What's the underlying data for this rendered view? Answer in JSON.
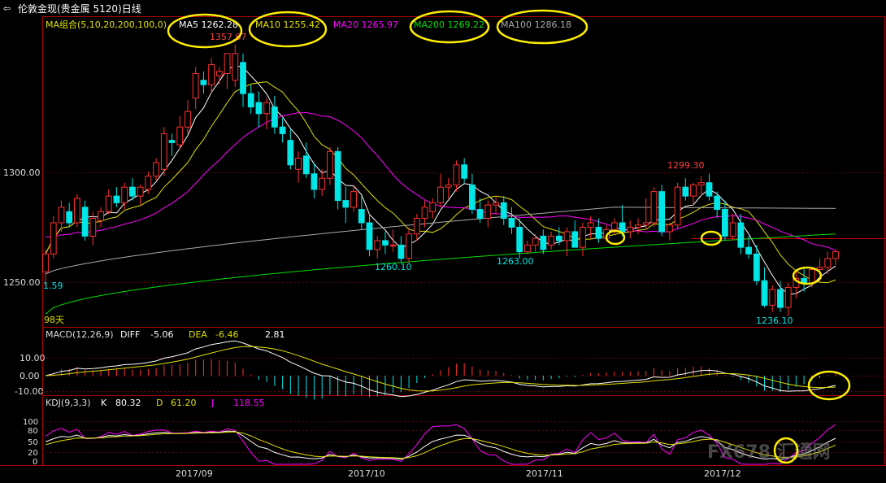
{
  "window": {
    "icon": "back-arrow-icon",
    "title": "伦敦金现(贵金属 5120)日线"
  },
  "legend": [
    {
      "text": "MA组合(5,10,20,200,100,0)",
      "color": "#e0e000"
    },
    {
      "text": "MA5 1262.28",
      "color": "#ffffff"
    },
    {
      "text": "MA10 1255.42",
      "color": "#e0e000"
    },
    {
      "text": "MA20 1265.97",
      "color": "#ff00ff"
    },
    {
      "text": "MA200 1269.22",
      "color": "#00dd00"
    },
    {
      "text": "MA100 1286.18",
      "color": "#aaaaaa"
    }
  ],
  "annotations": [
    {
      "text": "1357.67",
      "color": "#ff4040"
    },
    {
      "text": "1299.30",
      "color": "#ff4040"
    },
    {
      "text": "1260.10",
      "color": "#00e5e5"
    },
    {
      "text": "1263.00",
      "color": "#00e5e5"
    },
    {
      "text": "1236.10",
      "color": "#00e5e5"
    },
    {
      "text": "1.59",
      "color": "#00e5e5"
    },
    {
      "text": "98天",
      "color": "#e0e000"
    }
  ],
  "macd_header": {
    "title": "MACD(12,26,9)",
    "diff_label": "DIFF",
    "diff_value": "-5.06",
    "dea_label": "DEA",
    "dea_value": "-6.46",
    "macd_value": "2.81"
  },
  "kdj_header": {
    "title": "KDJ(9,3,3)",
    "k_label": "K",
    "k_value": "80.32",
    "d_label": "D",
    "d_value": "61.20",
    "j_label": "J",
    "j_value": "118.55"
  },
  "watermark": "FX678 汇通网",
  "chart_data": [
    {
      "type": "candlestick",
      "title": "伦敦金现(贵金属 5120)日线",
      "yticks": [
        "1300.00",
        "1250.00"
      ],
      "ylim": [
        1232,
        1370
      ],
      "xticks": [
        "2017/09",
        "2017/10",
        "2017/11",
        "2017/12"
      ],
      "candles_ohlc": [
        [
          1256,
          1266,
          1250,
          1264
        ],
        [
          1264,
          1281,
          1262,
          1278
        ],
        [
          1278,
          1288,
          1274,
          1285
        ],
        [
          1283,
          1287,
          1276,
          1278
        ],
        [
          1278,
          1291,
          1276,
          1289
        ],
        [
          1285,
          1288,
          1270,
          1272
        ],
        [
          1272,
          1283,
          1268,
          1280
        ],
        [
          1279,
          1285,
          1276,
          1283
        ],
        [
          1283,
          1293,
          1282,
          1290
        ],
        [
          1290,
          1294,
          1285,
          1287
        ],
        [
          1287,
          1296,
          1284,
          1294
        ],
        [
          1294,
          1298,
          1288,
          1290
        ],
        [
          1290,
          1295,
          1286,
          1294
        ],
        [
          1293,
          1301,
          1291,
          1299
        ],
        [
          1299,
          1307,
          1297,
          1305
        ],
        [
          1302,
          1321,
          1299,
          1318
        ],
        [
          1315,
          1318,
          1308,
          1314
        ],
        [
          1313,
          1326,
          1311,
          1321
        ],
        [
          1321,
          1333,
          1318,
          1328
        ],
        [
          1334,
          1348,
          1329,
          1345
        ],
        [
          1342,
          1346,
          1336,
          1340
        ],
        [
          1340,
          1352,
          1336,
          1349
        ],
        [
          1344,
          1348,
          1340,
          1346
        ],
        [
          1345,
          1352,
          1338,
          1354
        ],
        [
          1342,
          1358,
          1339,
          1354
        ],
        [
          1350,
          1354,
          1330,
          1336
        ],
        [
          1336,
          1340,
          1327,
          1330
        ],
        [
          1332,
          1337,
          1321,
          1327
        ],
        [
          1327,
          1334,
          1320,
          1332
        ],
        [
          1330,
          1335,
          1318,
          1321
        ],
        [
          1321,
          1325,
          1314,
          1318
        ],
        [
          1315,
          1320,
          1302,
          1304
        ],
        [
          1302,
          1310,
          1296,
          1307
        ],
        [
          1308,
          1314,
          1298,
          1300
        ],
        [
          1300,
          1305,
          1289,
          1293
        ],
        [
          1293,
          1302,
          1290,
          1298
        ],
        [
          1298,
          1312,
          1295,
          1310
        ],
        [
          1310,
          1312,
          1284,
          1288
        ],
        [
          1288,
          1294,
          1278,
          1285
        ],
        [
          1285,
          1295,
          1283,
          1292
        ],
        [
          1284,
          1290,
          1275,
          1278
        ],
        [
          1278,
          1282,
          1263,
          1266
        ],
        [
          1266,
          1272,
          1262,
          1270
        ],
        [
          1270,
          1274,
          1264,
          1268
        ],
        [
          1268,
          1275,
          1265,
          1268
        ],
        [
          1268,
          1272,
          1260,
          1262
        ],
        [
          1262,
          1276,
          1260,
          1273
        ],
        [
          1273,
          1282,
          1270,
          1280
        ],
        [
          1280,
          1288,
          1276,
          1285
        ],
        [
          1283,
          1289,
          1280,
          1287
        ],
        [
          1287,
          1300,
          1285,
          1294
        ],
        [
          1294,
          1298,
          1289,
          1295
        ],
        [
          1295,
          1306,
          1292,
          1304
        ],
        [
          1304,
          1307,
          1296,
          1298
        ],
        [
          1295,
          1300,
          1282,
          1284
        ],
        [
          1284,
          1289,
          1278,
          1280
        ],
        [
          1280,
          1288,
          1276,
          1286
        ],
        [
          1286,
          1290,
          1282,
          1287
        ],
        [
          1287,
          1290,
          1277,
          1280
        ],
        [
          1280,
          1285,
          1273,
          1276
        ],
        [
          1276,
          1280,
          1262,
          1265
        ],
        [
          1265,
          1270,
          1264,
          1268
        ],
        [
          1268,
          1273,
          1265,
          1271
        ],
        [
          1272,
          1275,
          1264,
          1266
        ],
        [
          1268,
          1274,
          1266,
          1272
        ],
        [
          1272,
          1276,
          1268,
          1270
        ],
        [
          1270,
          1276,
          1263,
          1274
        ],
        [
          1274,
          1279,
          1268,
          1267
        ],
        [
          1267,
          1278,
          1263,
          1276
        ],
        [
          1276,
          1281,
          1271,
          1278
        ],
        [
          1276,
          1280,
          1269,
          1271
        ],
        [
          1271,
          1277,
          1270,
          1275
        ],
        [
          1275,
          1280,
          1273,
          1278
        ],
        [
          1278,
          1286,
          1272,
          1274
        ],
        [
          1274,
          1279,
          1271,
          1276
        ],
        [
          1276,
          1280,
          1273,
          1277
        ],
        [
          1277,
          1289,
          1275,
          1278
        ],
        [
          1278,
          1294,
          1276,
          1292
        ],
        [
          1292,
          1295,
          1272,
          1274
        ],
        [
          1274,
          1278,
          1270,
          1277
        ],
        [
          1277,
          1296,
          1275,
          1294
        ],
        [
          1294,
          1298,
          1288,
          1290
        ],
        [
          1290,
          1296,
          1286,
          1295
        ],
        [
          1295,
          1299,
          1290,
          1296
        ],
        [
          1296,
          1300,
          1288,
          1290
        ],
        [
          1290,
          1292,
          1280,
          1284
        ],
        [
          1284,
          1288,
          1270,
          1272
        ],
        [
          1272,
          1282,
          1270,
          1278
        ],
        [
          1278,
          1282,
          1264,
          1267
        ],
        [
          1267,
          1272,
          1262,
          1264
        ],
        [
          1264,
          1268,
          1250,
          1252
        ],
        [
          1252,
          1258,
          1240,
          1241
        ],
        [
          1241,
          1250,
          1238,
          1248
        ],
        [
          1248,
          1252,
          1238,
          1240
        ],
        [
          1240,
          1251,
          1236,
          1249
        ],
        [
          1249,
          1256,
          1244,
          1253
        ],
        [
          1253,
          1258,
          1247,
          1251
        ],
        [
          1251,
          1258,
          1249,
          1257
        ],
        [
          1257,
          1262,
          1253,
          1258
        ],
        [
          1258,
          1265,
          1255,
          1262
        ],
        [
          1262,
          1266,
          1259,
          1265
        ]
      ],
      "marker_labels": {
        "max": "1357.67",
        "local_high": "1299.30",
        "lows": [
          "1260.10",
          "1263.00",
          "1236.10"
        ]
      },
      "series": [
        {
          "name": "MA5",
          "value": 1262.28,
          "color": "#ffffff"
        },
        {
          "name": "MA10",
          "value": 1255.42,
          "color": "#e0e000"
        },
        {
          "name": "MA20",
          "value": 1265.97,
          "color": "#ff00ff"
        },
        {
          "name": "MA200",
          "value": 1269.22,
          "color": "#00dd00"
        },
        {
          "name": "MA100",
          "value": 1286.18,
          "color": "#aaaaaa"
        }
      ],
      "grid": true
    },
    {
      "type": "line",
      "title": "MACD(12,26,9)",
      "yticks": [
        "10.00",
        "0.00",
        "-10.00"
      ],
      "ylim": [
        -12,
        18
      ],
      "series": [
        {
          "name": "DIFF",
          "last": -5.06,
          "color": "#ffffff"
        },
        {
          "name": "DEA",
          "last": -6.46,
          "color": "#e0e000"
        },
        {
          "name": "MACD",
          "last": 2.81,
          "color": "#ff4040"
        }
      ]
    },
    {
      "type": "line",
      "title": "KDJ(9,3,3)",
      "yticks": [
        "100",
        "80",
        "50",
        "20",
        "0"
      ],
      "ylim": [
        -5,
        125
      ],
      "series": [
        {
          "name": "K",
          "last": 80.32,
          "color": "#ffffff"
        },
        {
          "name": "D",
          "last": 61.2,
          "color": "#e0e000"
        },
        {
          "name": "J",
          "last": 118.55,
          "color": "#ff00ff"
        }
      ]
    }
  ]
}
